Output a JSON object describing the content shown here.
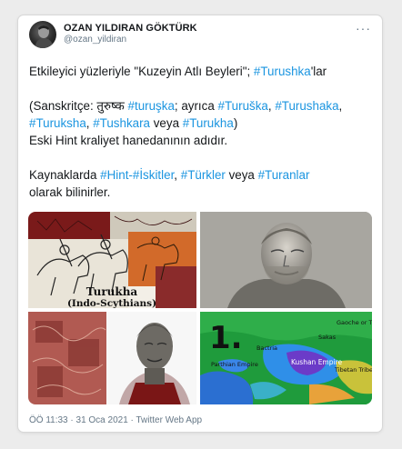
{
  "tweet": {
    "author_name": "OZAN YILDIRAN GÖKTÜRK",
    "author_handle": "@ozan_yildiran",
    "more_label": "···",
    "line1": {
      "pre": "Etkileyici yüzleriyle \"Kuzeyin Atlı Beyleri\"; ",
      "tag": "#Turushka",
      "post": "'lar"
    },
    "line2": {
      "pre": "(Sanskritçe: तुरुष्क ",
      "tag1": "#turuşka",
      "mid1": "; ayrıca ",
      "tag2": "#Turuška",
      "mid2": ", ",
      "tag3": "#Turushaka",
      "mid3": ","
    },
    "line3": {
      "tag1": "#Turuksha",
      "mid1": ", ",
      "tag2": "#Tushkara",
      "mid2": " veya ",
      "tag3": "#Turukha",
      "post": ")"
    },
    "line4": "Eski Hint kraliyet hanedanının adıdır.",
    "line5": {
      "pre": "Kaynaklarda ",
      "tag1": "#Hint-#İskitler",
      "mid1": ", ",
      "tag2": "#Türkler",
      "mid2": " veya ",
      "tag3": "#Turanlar"
    },
    "line6": "olarak bilinirler.",
    "media": {
      "img1_caption_1": "Turukha",
      "img1_caption_2": "(Indo-Scythians)",
      "img4_number": "1.",
      "img4_labels": {
        "gaoche": "Gaoche or Tiele",
        "kushan": "Kushan Empire",
        "parthian": "Parthian Empire",
        "bactria": "Bactria",
        "tibetan": "Tibetan Tribes",
        "sakas": "Sakas"
      }
    },
    "timestamp": "ÖÖ 11:33 · 31 Oca 2021 · Twitter Web App"
  },
  "colors": {
    "link": "#1b95e0",
    "text": "#14171a",
    "muted": "#657786"
  }
}
